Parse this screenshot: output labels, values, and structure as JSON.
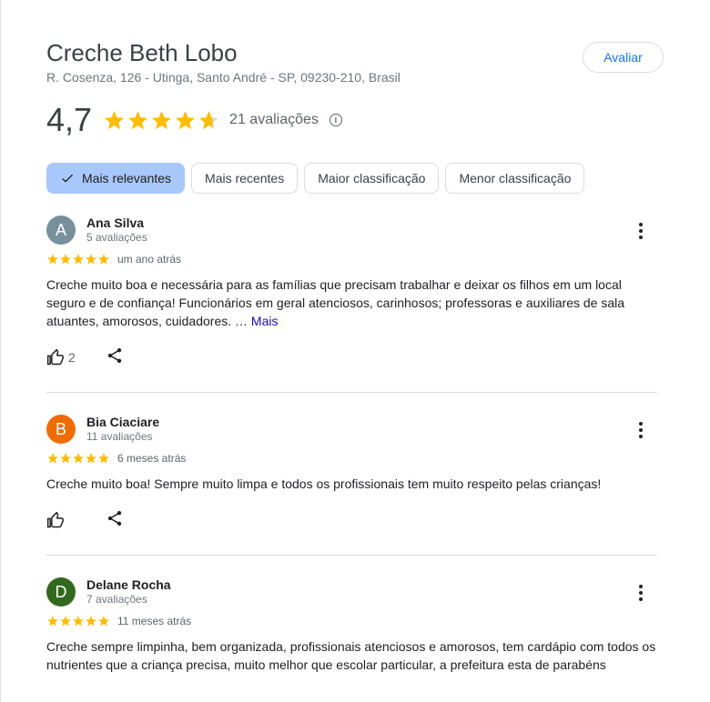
{
  "place": {
    "name": "Creche Beth Lobo",
    "address": "R. Cosenza, 126 - Utinga, Santo André - SP, 09230-210, Brasil",
    "rate_button": "Avaliar",
    "average": "4,7",
    "average_value": 4.7,
    "reviews_count": "21 avaliações",
    "info_glyph": "i"
  },
  "filters": [
    {
      "label": "Mais relevantes",
      "active": true
    },
    {
      "label": "Mais recentes",
      "active": false
    },
    {
      "label": "Maior classificação",
      "active": false
    },
    {
      "label": "Menor classificação",
      "active": false
    }
  ],
  "colors": {
    "star": "#fbbc04",
    "star_empty": "#dadce0",
    "chip_active_bg": "#a8c7fa",
    "link": "#1a0dab"
  },
  "reviews": [
    {
      "initial": "A",
      "avatar_color": "#78909c",
      "name": "Ana Silva",
      "count": "5 avaliações",
      "stars": 5,
      "when": "um ano atrás",
      "text": "Creche muito boa e necessária para as famílias que precisam trabalhar e deixar os filhos em um local seguro e de confiança! Funcionários em geral atenciosos, carinhosos; professoras e auxiliares de sala atuantes, amorosos, cuidadores. …",
      "more": "Mais",
      "likes": "2"
    },
    {
      "initial": "B",
      "avatar_color": "#ef6c00",
      "name": "Bia Ciaciare",
      "count": "11 avaliações",
      "stars": 5,
      "when": "6 meses atrás",
      "text": "Creche muito boa! Sempre muito limpa e todos os profissionais tem muito respeito pelas crianças!"
    },
    {
      "initial": "D",
      "avatar_color": "#33691e",
      "name": "Delane Rocha",
      "count": "7 avaliações",
      "stars": 5,
      "when": "11 meses atrás",
      "text": "Creche sempre limpinha, bem organizada, profissionais atenciosos e amorosos, tem cardápio com todos os nutrientes que a criança precisa, muito melhor que escolar particular, a prefeitura esta de parabéns"
    }
  ]
}
